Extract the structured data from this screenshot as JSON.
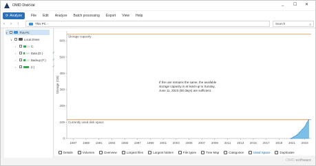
{
  "window": {
    "title": "OMD DiskVal",
    "min": "_",
    "max": "☐",
    "close": "✕"
  },
  "menu": {
    "active": "Analyze",
    "items": [
      "File",
      "Edit",
      "Analyze",
      "Batch processing",
      "Export",
      "View",
      "Help"
    ]
  },
  "nav": {
    "back": "‹",
    "forward": "›",
    "up": "↑",
    "path": "This PC",
    "search_placeholder": "Search"
  },
  "tree": [
    {
      "label": "This PC",
      "toggle": "∨",
      "selected": true,
      "indent": 0,
      "drive": false
    },
    {
      "label": "Local drives",
      "toggle": "∨",
      "selected": false,
      "indent": 1,
      "drive": false
    },
    {
      "label": "C:",
      "toggle": "›",
      "selected": false,
      "indent": 2,
      "drive": true,
      "fill": 0.45,
      "ok": false
    },
    {
      "label": "Data (D:)",
      "toggle": "›",
      "selected": false,
      "indent": 2,
      "drive": true,
      "fill": 0.18,
      "ok": true
    },
    {
      "label": "Backup (F:)",
      "toggle": "›",
      "selected": false,
      "indent": 2,
      "drive": true,
      "fill": 0.35,
      "ok": true
    },
    {
      "label": "(I:)",
      "toggle": "›",
      "selected": false,
      "indent": 2,
      "drive": true,
      "fill": 0.9,
      "ok": true
    }
  ],
  "chart_data": {
    "type": "area",
    "ylabel": "Storage (GB)",
    "ylim": [
      0,
      600
    ],
    "yticks": [
      0,
      100,
      200,
      300,
      400,
      500,
      600
    ],
    "xticks": [
      "1987",
      "1989",
      "1991",
      "1993",
      "1995",
      "1997",
      "1999",
      "2001",
      "2003",
      "2005",
      "2007",
      "2009",
      "2011",
      "2013",
      "2015",
      "2017",
      "2019",
      "2021",
      "2023"
    ],
    "xlim": [
      1986,
      2024
    ],
    "storage_capacity": 640,
    "capacity_label": "Storage capacity",
    "used_disk_space": 115,
    "used_label": "Currently used disk space",
    "annotation": "If the use remains the same, the available storage capacity is at least up to Sunday, June 11, 2023 (90 days) are sufficient.",
    "series": [
      {
        "x": [
          2020.8,
          2021.3,
          2021.8,
          2022.2,
          2022.6,
          2023.0,
          2023.3,
          2023.6
        ],
        "y": [
          0,
          10,
          22,
          38,
          55,
          72,
          95,
          115
        ]
      }
    ]
  },
  "tabs": [
    "Details",
    "Volumes",
    "Overview",
    "Largest files",
    "Largest folders",
    "File types",
    "Tree Map",
    "Categories",
    "Used Space",
    "Duplicates"
  ],
  "active_tab": "Used Space",
  "brand": {
    "prefix": "OMD ",
    "name": "software"
  },
  "colors": {
    "accent": "#2b6fb6",
    "capacity_line": "#e08a3c",
    "area": "#7cc0e8",
    "area_stroke": "#2f8fd0"
  }
}
